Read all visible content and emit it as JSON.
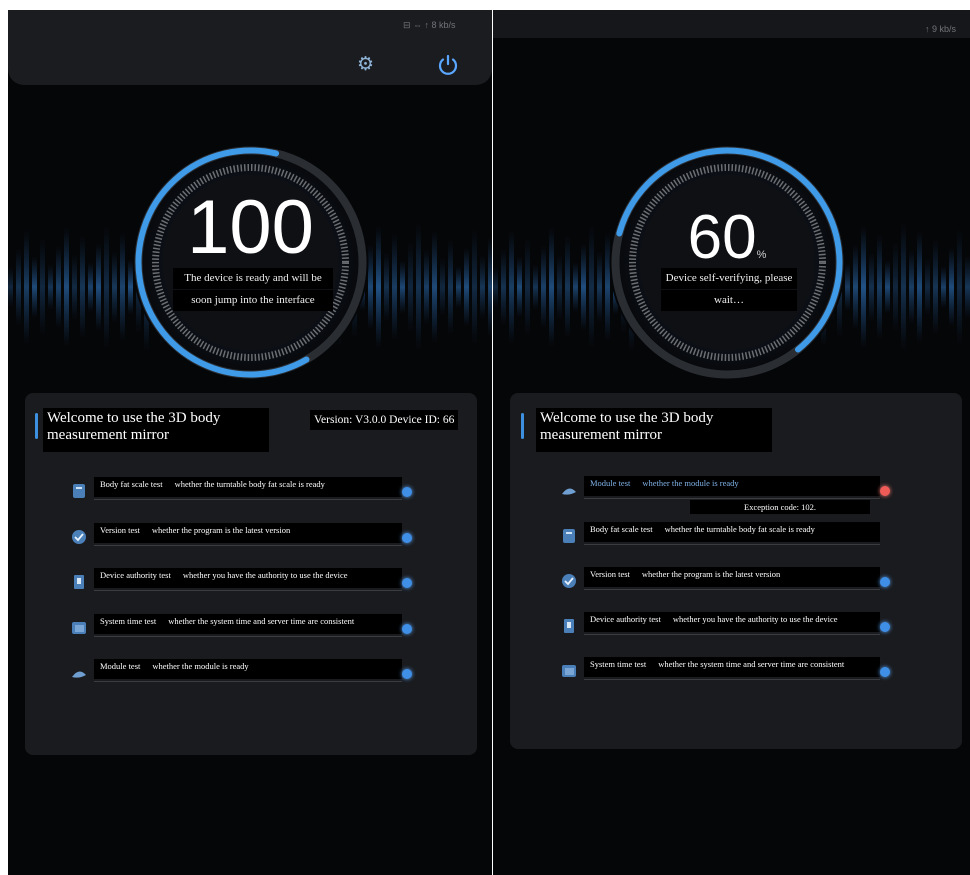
{
  "left_screen": {
    "status_text": "⊟ ⇔ ↑ 8 kb/s",
    "progress": {
      "value": "100",
      "fraction": 1.0,
      "message": [
        "The device is ready and will be",
        "soon jump into the interface"
      ]
    },
    "welcome": [
      "Welcome to use the 3D body",
      "measurement mirror"
    ],
    "version": "Version: V3.0.0    Device ID: 66",
    "tests": [
      {
        "name": "Body fat scale test",
        "desc": "whether the turntable body fat scale is ready",
        "status": "ok",
        "icon": "scale-icon"
      },
      {
        "name": "Version test",
        "desc": "whether the program is the latest version",
        "status": "ok",
        "icon": "version-icon"
      },
      {
        "name": "Device authority test",
        "desc": "whether you have the authority to use the device",
        "status": "ok",
        "icon": "authority-icon"
      },
      {
        "name": "System time test",
        "desc": "whether the system time and server time are consistent",
        "status": "ok",
        "icon": "clock-icon"
      },
      {
        "name": "Module test",
        "desc": "whether the module is ready",
        "status": "ok",
        "icon": "module-icon"
      }
    ]
  },
  "right_screen": {
    "status_text": "↑ 9 kb/s",
    "progress": {
      "value": "60",
      "unit": "%",
      "fraction": 0.6,
      "message": [
        "Device self-verifying, please",
        "wait…"
      ]
    },
    "welcome": [
      "Welcome to use the 3D body",
      "measurement mirror"
    ],
    "tests": [
      {
        "name": "Module test",
        "desc": "whether the module is ready",
        "status": "error",
        "icon": "module-icon",
        "exception": "Exception code: 102."
      },
      {
        "name": "Body fat scale test",
        "desc": "whether the turntable body fat scale is ready",
        "status": "none",
        "icon": "scale-icon"
      },
      {
        "name": "Version test",
        "desc": "whether the program is the latest version",
        "status": "ok",
        "icon": "version-icon"
      },
      {
        "name": "Device authority test",
        "desc": "whether you have the authority to use the device",
        "status": "ok",
        "icon": "authority-icon"
      },
      {
        "name": "System time test",
        "desc": "whether the system time and server time are consistent",
        "status": "ok",
        "icon": "clock-icon"
      }
    ]
  },
  "colors": {
    "accent": "#3f8fe6",
    "error": "#ef5b57",
    "panel": "#1a1b1e",
    "background": "#050608"
  }
}
